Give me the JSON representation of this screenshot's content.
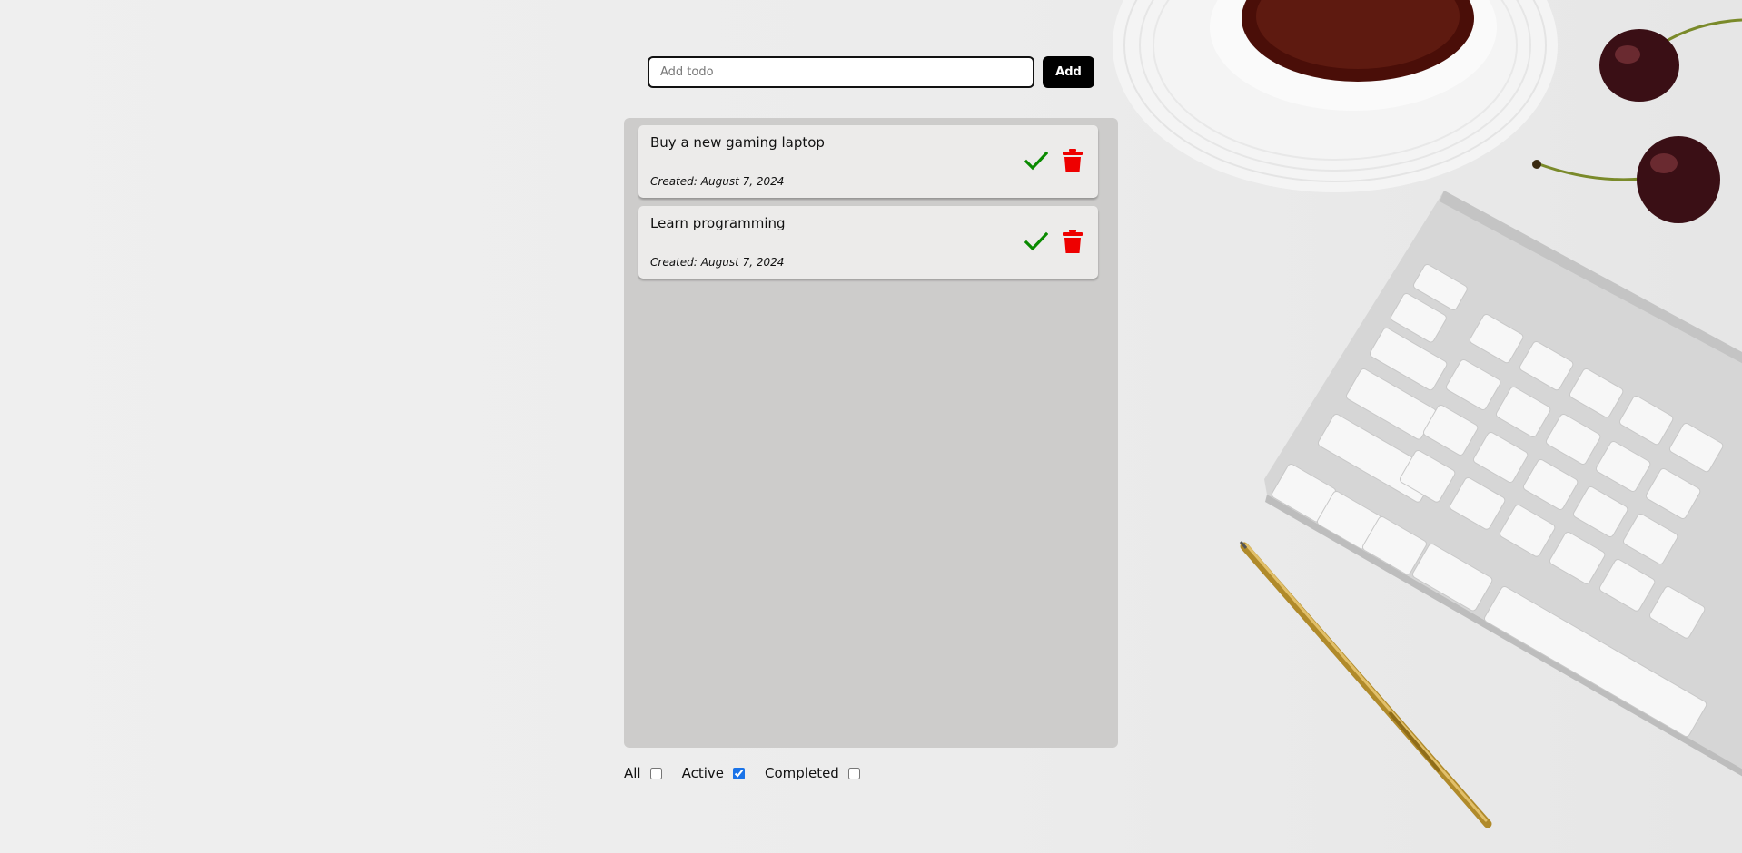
{
  "input": {
    "placeholder": "Add todo",
    "value": ""
  },
  "add_label": "Add",
  "todos": [
    {
      "title": "Buy a new gaming laptop",
      "created_prefix": "Created:",
      "created_date": "August 7, 2024",
      "done_icon": "checkmark-icon",
      "delete_icon": "trash-icon"
    },
    {
      "title": "Learn programming",
      "created_prefix": "Created:",
      "created_date": "August 7, 2024",
      "done_icon": "checkmark-icon",
      "delete_icon": "trash-icon"
    }
  ],
  "filters": [
    {
      "label": "All",
      "checked": false
    },
    {
      "label": "Active",
      "checked": true
    },
    {
      "label": "Completed",
      "checked": false
    }
  ],
  "colors": {
    "check": "#0a8a00",
    "delete": "#ee0000",
    "panel": "#cdcccb",
    "item": "#ecebea",
    "button": "#000000"
  }
}
